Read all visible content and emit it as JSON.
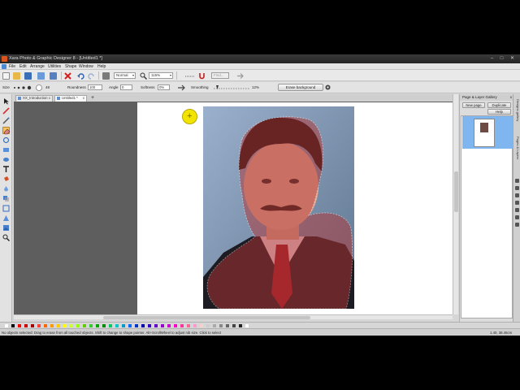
{
  "window": {
    "title": "Xara Photo & Graphic Designer 8 - [Untitled1 *]",
    "min_glyph": "–",
    "max_glyph": "□",
    "close_glyph": "✕"
  },
  "menu": {
    "items": [
      "File",
      "Edit",
      "Arrange",
      "Utilities",
      "Shape",
      "Window",
      "Help"
    ]
  },
  "toolbar": {
    "quality_value": "Normal",
    "zoom_value": "115%",
    "dropdown_arrow": "▾",
    "disabled_field": "Find..."
  },
  "infobar": {
    "size_label": "Size",
    "size_value": "48",
    "roundness_label": "Roundness",
    "roundness_value": "100",
    "angle_label": "Angle",
    "angle_value": "0",
    "softness_label": "Softness",
    "softness_value": "0%",
    "smoothing_label": "Smoothing",
    "smoothing_value": "12%",
    "erase_button": "Erase background"
  },
  "doc_tabs": {
    "tabs": [
      {
        "label": "XX_Introduction",
        "active": false
      },
      {
        "label": "Untitled1 *",
        "active": true
      }
    ],
    "close_glyph": "x",
    "add_glyph": "+"
  },
  "gallery": {
    "title": "Page & Layer Gallery",
    "close_glyph": "x",
    "new_page_button": "New page",
    "duplicate_button": "Duplicate",
    "help_button": "Help",
    "side_tabs": [
      "Designs gallery",
      "Pages & Layers"
    ]
  },
  "palette": {
    "colors": [
      "#ffffff",
      "#000000",
      "#ff0000",
      "#d00000",
      "#a00000",
      "#ff4040",
      "#ff6600",
      "#ff9900",
      "#ffcc00",
      "#ffff00",
      "#ccff33",
      "#99ff00",
      "#66cc00",
      "#33cc33",
      "#00aa00",
      "#008800",
      "#00cc66",
      "#00cccc",
      "#0099cc",
      "#0066ff",
      "#0033cc",
      "#0000aa",
      "#3300cc",
      "#6600cc",
      "#9900cc",
      "#cc00cc",
      "#ff00cc",
      "#ff3399",
      "#ff6699",
      "#ff99cc",
      "#ffcccc",
      "#cccccc",
      "#aaaaaa",
      "#888888",
      "#666666",
      "#444444",
      "#222222",
      "#ffffff"
    ]
  },
  "status": {
    "message": "No objects selected: Drag to erase from all touched objects. Shift to change to shape pointer. Alt+ScrollWheel to adjust nib size. Click to select",
    "coords": "1.40, 38.45cm"
  }
}
